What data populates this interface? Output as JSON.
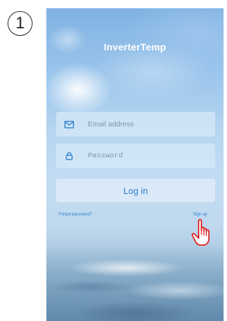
{
  "step": {
    "number": "1"
  },
  "app": {
    "title": "InverterTemp"
  },
  "login_form": {
    "email_placeholder": "Email address",
    "password_placeholder": "Password",
    "login_label": "Log in",
    "forgot_label": "Forgot password?",
    "signup_label": "Sign up"
  },
  "icons": {
    "email": "envelope-icon",
    "password": "lock-icon",
    "pointer": "pointing-hand-icon"
  },
  "colors": {
    "accent": "#2f7fcf",
    "pointer": "#e02020"
  }
}
